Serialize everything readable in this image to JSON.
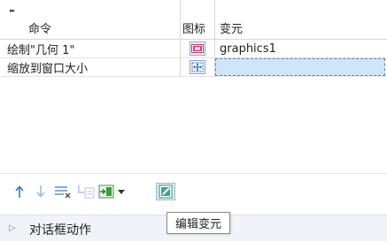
{
  "table": {
    "expand_glyph": "▸▸",
    "headers": {
      "command": "命令",
      "icon": "图标",
      "variable": "变元"
    },
    "rows": [
      {
        "command": "绘制\"几何 1\"",
        "icon": "graphics-icon",
        "variable": "graphics1"
      },
      {
        "command": "缩放到窗口大小",
        "icon": "zoom-extents-icon",
        "variable": ""
      }
    ]
  },
  "toolbar": {
    "buttons": [
      {
        "name": "move-up",
        "icon": "arrow-up-icon"
      },
      {
        "name": "move-down",
        "icon": "arrow-down-icon"
      },
      {
        "name": "delete",
        "icon": "delete-rows-icon"
      },
      {
        "name": "extract",
        "icon": "extract-icon"
      },
      {
        "name": "insert",
        "icon": "insert-icon"
      },
      {
        "name": "edit-variable",
        "icon": "edit-icon"
      }
    ],
    "tooltip": "编辑变元"
  },
  "section": {
    "title": "对话框动作",
    "chevron": "▷"
  },
  "colors": {
    "accent": "#2a7bd1",
    "selection": "#cfe6fa"
  }
}
